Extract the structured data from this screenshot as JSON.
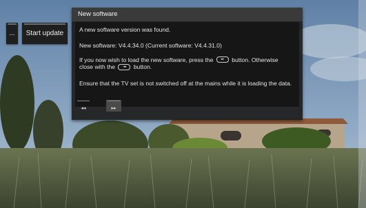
{
  "side_button": {
    "label": "..."
  },
  "start_update": {
    "label": "Start update"
  },
  "dialog": {
    "title": "New software",
    "line1": "A new software version was found.",
    "line2": "New software:  V4.4.34.0   (Current software:  V4.4.31.0)",
    "line3_a": "If you now wish to load the new software, press the",
    "line3_b": "button. Otherwise close with the",
    "line3_c": "button.",
    "line4": "Ensure that the TV set is not switched off at the mains while it is loading the data."
  },
  "inline_buttons": {
    "next_icon": "next-icon",
    "back_icon": "back-icon"
  },
  "nav": {
    "prev_label": "◂◂",
    "next_label": "▸▸"
  }
}
